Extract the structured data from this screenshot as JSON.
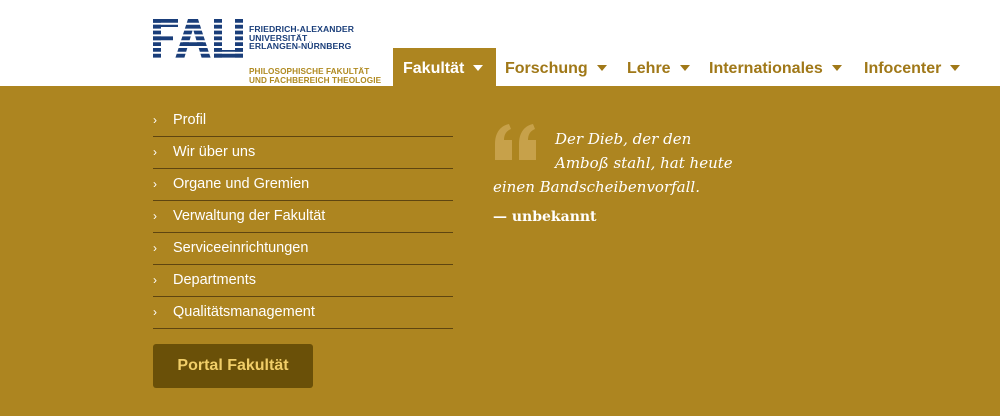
{
  "logo": {
    "university_lines": [
      "FRIEDRICH-ALEXANDER",
      "UNIVERSITÄT",
      "ERLANGEN-NÜRNBERG"
    ],
    "faculty_lines": [
      "PHILOSOPHISCHE FAKULTÄT",
      "UND FACHBEREICH THEOLOGIE"
    ],
    "mark_text": "FAU",
    "colors": {
      "blue": "#1a3e7a",
      "gold": "#b08a20"
    }
  },
  "nav": {
    "items": [
      {
        "label": "Fakultät",
        "active": true
      },
      {
        "label": "Forschung",
        "active": false
      },
      {
        "label": "Lehre",
        "active": false
      },
      {
        "label": "Internationales",
        "active": false
      },
      {
        "label": "Infocenter",
        "active": false
      }
    ]
  },
  "mega_menu": {
    "links": [
      "Profil",
      "Wir über uns",
      "Organe und Gremien",
      "Verwaltung der Fakultät",
      "Serviceeinrichtungen",
      "Departments",
      "Qualitätsmanagement"
    ],
    "portal_button": "Portal Fakultät",
    "quote": {
      "lines": [
        "Der Dieb, der den",
        "Amboß stahl, hat heute",
        "einen Bandscheibenvorfall."
      ],
      "author": "— unbekannt"
    }
  },
  "colors": {
    "gold_bg": "#ad8520",
    "button_bg": "#6a5008",
    "button_text": "#f1ce68",
    "nav_text": "#a07818",
    "divider": "#5e4510"
  },
  "icons": {
    "menu_chevron": "chevron-right-icon",
    "nav_caret": "caret-down-icon",
    "quote": "quote-icon"
  }
}
